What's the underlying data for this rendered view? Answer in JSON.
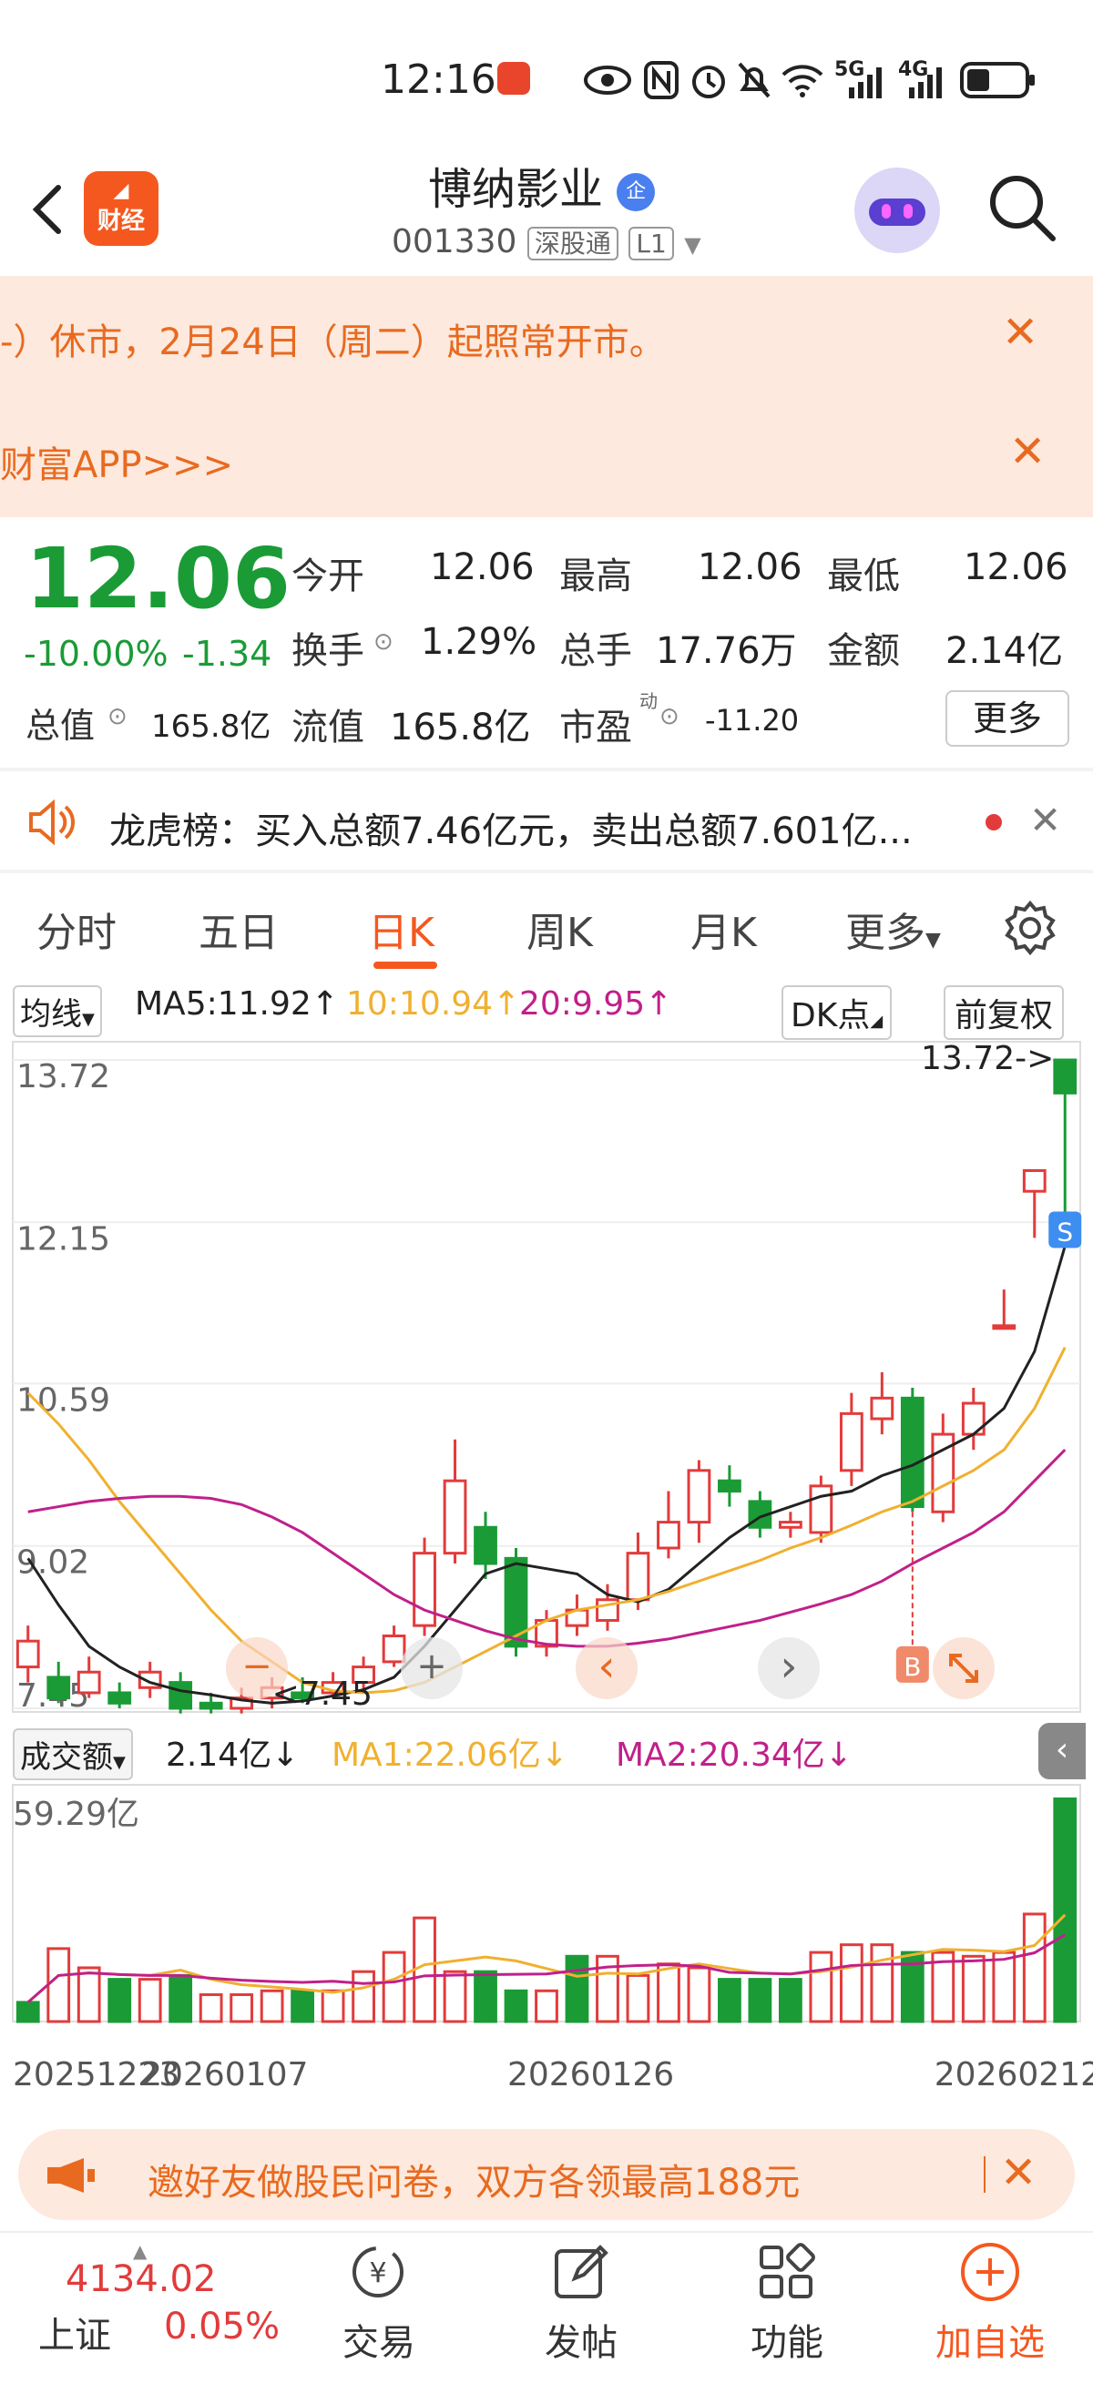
{
  "status_bar": {
    "time": "12:16",
    "net1": "5G",
    "net2": "4G"
  },
  "header": {
    "logo_text": "财经",
    "stock_name": "博纳影业",
    "badge": "企",
    "code": "001330",
    "market_tag": "深股通",
    "level_tag": "L1"
  },
  "banners": [
    {
      "text": "-）休市，2月24日（周二）起照常开市。"
    },
    {
      "text": "财富APP>>>"
    }
  ],
  "quote": {
    "price": "12.06",
    "change_pct": "-10.00%",
    "change_amt": "-1.34",
    "open_label": "今开",
    "open": "12.06",
    "high_label": "最高",
    "high": "12.06",
    "low_label": "最低",
    "low": "12.06",
    "turnover_label": "换手",
    "turnover": "1.29%",
    "volume_label": "总手",
    "volume": "17.76万",
    "amount_label": "金额",
    "amount": "2.14亿",
    "mcap_label": "总值",
    "mcap": "165.8亿",
    "float_label": "流值",
    "float": "165.8亿",
    "pe_label": "市盈",
    "pe_sup": "动",
    "pe": "-11.20",
    "more": "更多"
  },
  "notice": {
    "text": "龙虎榜：买入总额7.46亿元，卖出总额7.601亿..."
  },
  "tabs": [
    "分时",
    "五日",
    "日K",
    "周K",
    "月K",
    "更多"
  ],
  "active_tab": 2,
  "ma_bar": {
    "selector": "均线",
    "ma5": "MA5:11.92↑",
    "ma10": "10:10.94↑",
    "ma20": "20:9.95↑",
    "dk": "DK点",
    "adjust": "前复权"
  },
  "vol_bar": {
    "selector": "成交额",
    "value": "2.14亿↓",
    "ma1": "MA1:22.06亿↓",
    "ma2": "MA2:20.34亿↓"
  },
  "colors": {
    "up": "#e23b3b",
    "down": "#1a9b36",
    "ma5": "#222222",
    "ma10": "#f0b030",
    "ma20": "#c0208a",
    "accent": "#f5581f"
  },
  "chart_data": {
    "type": "candlestick",
    "y_ticks": [
      "13.72",
      "12.15",
      "10.59",
      "9.02",
      "7.45"
    ],
    "ylim": [
      7.45,
      13.72
    ],
    "high_marker": "13.72->",
    "low_marker": "<7.45",
    "x_ticks": [
      "20251223",
      "20260107",
      "20260126",
      "20260212"
    ],
    "signals": [
      {
        "label": "S"
      },
      {
        "label": "B"
      }
    ],
    "candles": [
      {
        "o": 7.85,
        "c": 8.1,
        "h": 8.25,
        "l": 7.7
      },
      {
        "o": 7.75,
        "c": 7.55,
        "h": 7.9,
        "l": 7.5
      },
      {
        "o": 7.6,
        "c": 7.8,
        "h": 7.95,
        "l": 7.55
      },
      {
        "o": 7.6,
        "c": 7.5,
        "h": 7.7,
        "l": 7.45
      },
      {
        "o": 7.65,
        "c": 7.8,
        "h": 7.9,
        "l": 7.55
      },
      {
        "o": 7.7,
        "c": 7.45,
        "h": 7.8,
        "l": 7.4
      },
      {
        "o": 7.5,
        "c": 7.45,
        "h": 7.6,
        "l": 7.4
      },
      {
        "o": 7.45,
        "c": 7.55,
        "h": 7.65,
        "l": 7.4
      },
      {
        "o": 7.55,
        "c": 7.65,
        "h": 7.75,
        "l": 7.45
      },
      {
        "o": 7.6,
        "c": 7.55,
        "h": 7.75,
        "l": 7.5
      },
      {
        "o": 7.6,
        "c": 7.7,
        "h": 7.8,
        "l": 7.55
      },
      {
        "o": 7.7,
        "c": 7.85,
        "h": 7.95,
        "l": 7.6
      },
      {
        "o": 7.9,
        "c": 8.15,
        "h": 8.25,
        "l": 7.85
      },
      {
        "o": 8.25,
        "c": 8.95,
        "h": 9.1,
        "l": 8.15
      },
      {
        "o": 8.95,
        "c": 9.65,
        "h": 10.05,
        "l": 8.85
      },
      {
        "o": 9.2,
        "c": 8.85,
        "h": 9.35,
        "l": 8.7
      },
      {
        "o": 8.9,
        "c": 8.05,
        "h": 9.0,
        "l": 7.95
      },
      {
        "o": 8.05,
        "c": 8.3,
        "h": 8.4,
        "l": 7.95
      },
      {
        "o": 8.25,
        "c": 8.4,
        "h": 8.55,
        "l": 8.15
      },
      {
        "o": 8.3,
        "c": 8.5,
        "h": 8.65,
        "l": 8.2
      },
      {
        "o": 8.5,
        "c": 8.95,
        "h": 9.15,
        "l": 8.4
      },
      {
        "o": 9.0,
        "c": 9.25,
        "h": 9.55,
        "l": 8.9
      },
      {
        "o": 9.25,
        "c": 9.75,
        "h": 9.85,
        "l": 9.05
      },
      {
        "o": 9.65,
        "c": 9.55,
        "h": 9.8,
        "l": 9.4
      },
      {
        "o": 9.45,
        "c": 9.2,
        "h": 9.55,
        "l": 9.1
      },
      {
        "o": 9.2,
        "c": 9.25,
        "h": 9.35,
        "l": 9.1
      },
      {
        "o": 9.15,
        "c": 9.6,
        "h": 9.7,
        "l": 9.05
      },
      {
        "o": 9.75,
        "c": 10.3,
        "h": 10.5,
        "l": 9.6
      },
      {
        "o": 10.25,
        "c": 10.45,
        "h": 10.7,
        "l": 10.1
      },
      {
        "o": 10.45,
        "c": 9.4,
        "h": 10.55,
        "l": 9.35
      },
      {
        "o": 9.35,
        "c": 10.1,
        "h": 10.3,
        "l": 9.25
      },
      {
        "o": 10.1,
        "c": 10.4,
        "h": 10.55,
        "l": 9.95
      },
      {
        "o": 11.15,
        "c": 11.15,
        "h": 11.5,
        "l": 11.15
      },
      {
        "o": 12.45,
        "c": 12.65,
        "h": 12.65,
        "l": 12.0
      },
      {
        "o": 13.72,
        "c": 13.4,
        "h": 13.72,
        "l": 12.06
      }
    ],
    "ma5": [
      8.9,
      8.45,
      8.05,
      7.85,
      7.7,
      7.62,
      7.58,
      7.53,
      7.5,
      7.52,
      7.57,
      7.63,
      7.75,
      8.05,
      8.4,
      8.75,
      8.85,
      8.8,
      8.75,
      8.55,
      8.48,
      8.6,
      8.85,
      9.1,
      9.3,
      9.4,
      9.5,
      9.55,
      9.7,
      9.8,
      9.95,
      10.1,
      10.35,
      10.9,
      11.92
    ],
    "ma10": [
      10.5,
      10.2,
      9.85,
      9.45,
      9.1,
      8.75,
      8.4,
      8.1,
      7.9,
      7.7,
      7.62,
      7.6,
      7.62,
      7.7,
      7.85,
      8.0,
      8.15,
      8.3,
      8.4,
      8.45,
      8.5,
      8.58,
      8.68,
      8.78,
      8.88,
      9.0,
      9.1,
      9.22,
      9.35,
      9.45,
      9.6,
      9.75,
      9.95,
      10.35,
      10.94
    ],
    "ma20": [
      9.35,
      9.4,
      9.45,
      9.48,
      9.5,
      9.5,
      9.48,
      9.42,
      9.3,
      9.15,
      8.95,
      8.75,
      8.55,
      8.4,
      8.3,
      8.2,
      8.12,
      8.07,
      8.05,
      8.05,
      8.08,
      8.12,
      8.18,
      8.24,
      8.3,
      8.38,
      8.46,
      8.55,
      8.68,
      8.85,
      9.0,
      9.15,
      9.35,
      9.65,
      9.95
    ],
    "volume_ylabel": "59.29亿",
    "volume_max": 59.29,
    "volumes": [
      5,
      19,
      14,
      11,
      11,
      12,
      7,
      7,
      8,
      8,
      8,
      13,
      18,
      27,
      13,
      13,
      8,
      8,
      17,
      17,
      12,
      15,
      14,
      11,
      11,
      11,
      18,
      20,
      20,
      18,
      18,
      17,
      18,
      28,
      58
    ],
    "vol_up": [
      false,
      true,
      true,
      false,
      true,
      false,
      true,
      true,
      true,
      false,
      true,
      true,
      true,
      true,
      true,
      false,
      false,
      true,
      false,
      true,
      true,
      true,
      true,
      false,
      false,
      false,
      true,
      true,
      true,
      false,
      true,
      true,
      true,
      true,
      false
    ]
  },
  "chart_controls": {
    "zoom_out": "−",
    "zoom_in": "+",
    "prev": "‹",
    "next": "›"
  },
  "promo": {
    "text": "邀好友做股民问卷，双方各领最高188元"
  },
  "bottom_nav": {
    "index_value": "4134.02",
    "index_name": "上证",
    "index_change": "0.05%",
    "items": [
      "交易",
      "发帖",
      "功能",
      "加自选"
    ]
  }
}
